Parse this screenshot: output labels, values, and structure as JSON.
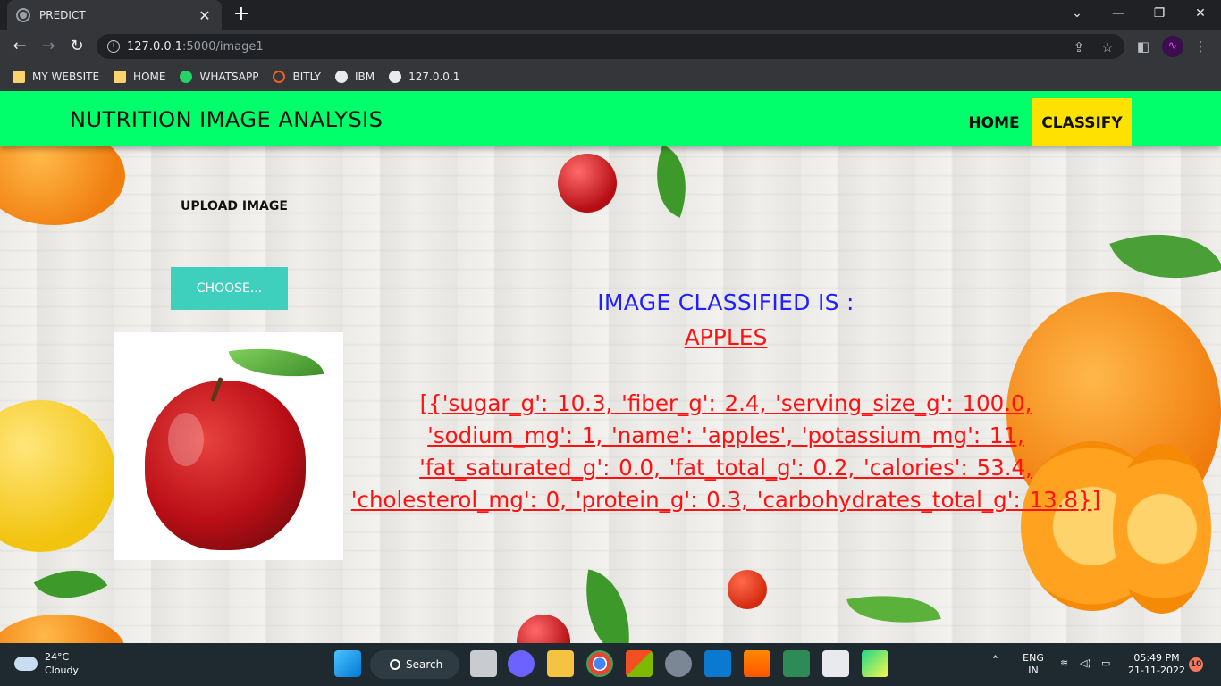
{
  "browser": {
    "tab_title": "PREDICT",
    "tab_close": "✕",
    "new_tab": "+",
    "url_host": "127.0.0.1",
    "url_path": ":5000/image1",
    "window_minimize": "—",
    "window_restore": "❐",
    "window_close": "✕",
    "bookmarks": [
      {
        "label": "MY WEBSITE",
        "icon": "folder-icon"
      },
      {
        "label": "HOME",
        "icon": "folder-icon"
      },
      {
        "label": "WHATSAPP",
        "icon": "whatsapp-icon"
      },
      {
        "label": "BITLY",
        "icon": "bitly-icon"
      },
      {
        "label": "IBM",
        "icon": "globe-icon"
      },
      {
        "label": "127.0.0.1",
        "icon": "globe-icon"
      }
    ]
  },
  "navbar": {
    "brand": "NUTRITION IMAGE ANALYSIS",
    "home": "HOME",
    "classify": "CLASSIFY"
  },
  "upload": {
    "label": "UPLOAD IMAGE",
    "choose_button": "CHOOSE..."
  },
  "result": {
    "title": "IMAGE CLASSIFIED IS :",
    "class_name": "APPLES",
    "nutrition": "[{'sugar_g': 10.3, 'fiber_g': 2.4, 'serving_size_g': 100.0, 'sodium_mg': 1, 'name': 'apples', 'potassium_mg': 11, 'fat_saturated_g': 0.0, 'fat_total_g': 0.2, 'calories': 53.4, 'cholesterol_mg': 0, 'protein_g': 0.3, 'carbohydrates_total_g': 13.8}]"
  },
  "taskbar": {
    "temperature": "24°C",
    "weather": "Cloudy",
    "search": "Search",
    "language": "ENG",
    "region": "IN",
    "time": "05:49 PM",
    "date": "21-11-2022",
    "notifications": "10"
  },
  "colors": {
    "navbar_bg": "#00ff6a",
    "classify_bg": "#ffe100",
    "choose_bg": "#3ecfbd",
    "title_blue": "#1f1fff",
    "result_red": "#ff1111"
  }
}
